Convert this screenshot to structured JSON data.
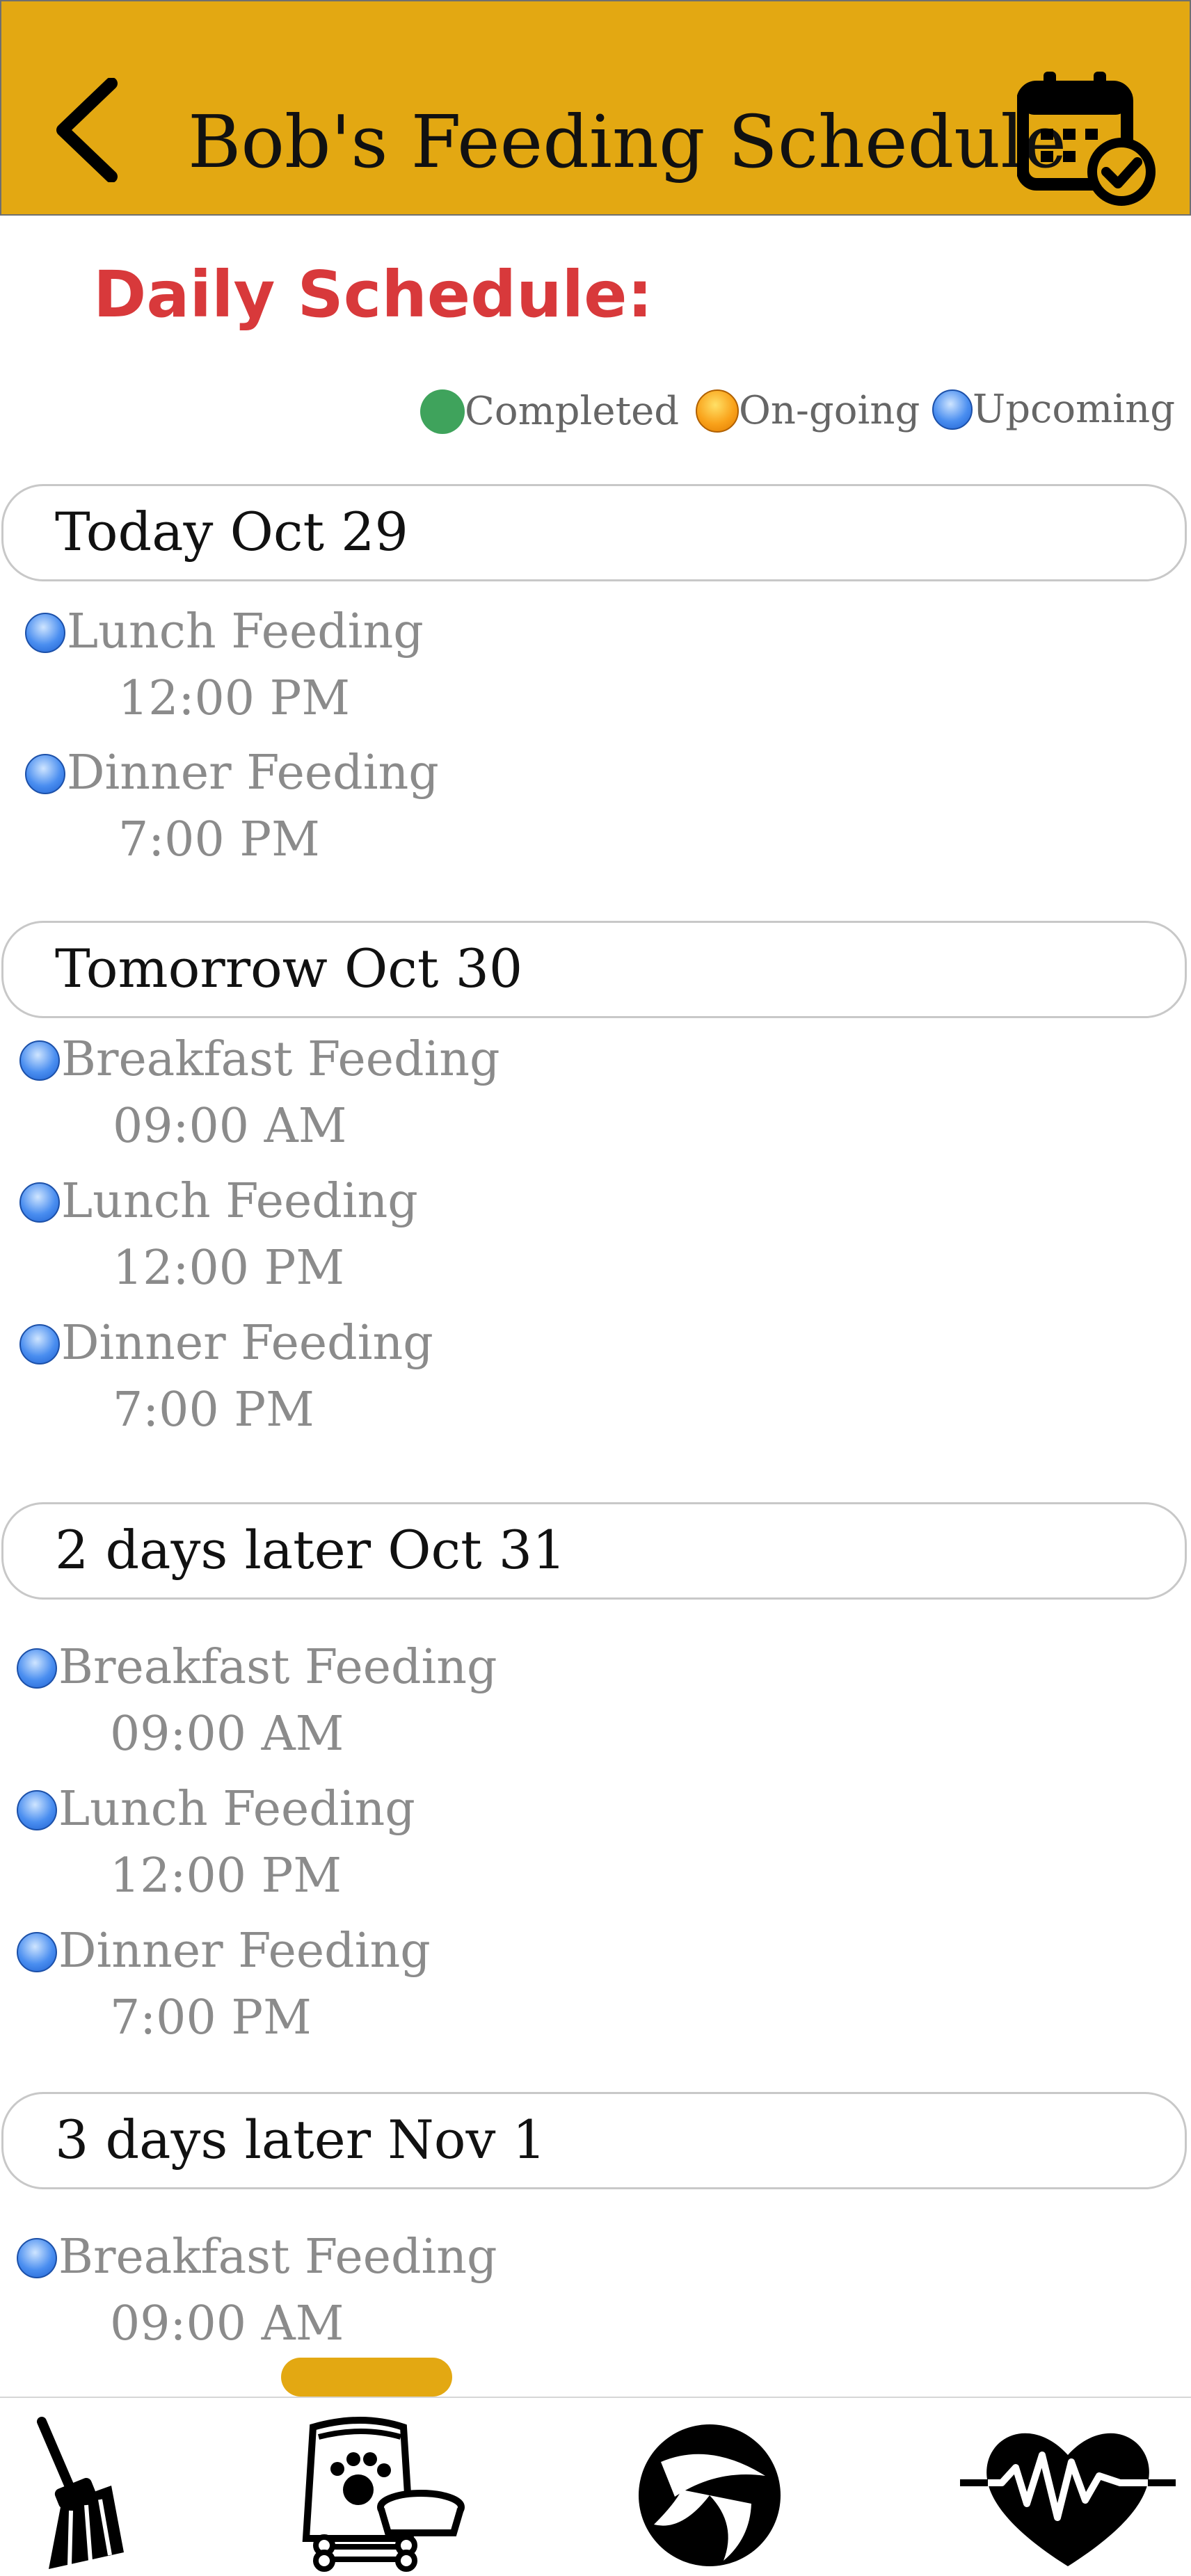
{
  "header": {
    "title": "Bob's Feeding Schedule"
  },
  "section_title": "Daily Schedule:",
  "legend": [
    {
      "label": "Completed",
      "color": "#3fa35c"
    },
    {
      "label": "On-going",
      "color": "#f9a21a"
    },
    {
      "label": "Upcoming",
      "color": "#4a8ef0"
    }
  ],
  "days": [
    {
      "label": "Today Oct 29",
      "items": [
        {
          "name": "Lunch Feeding",
          "time": "12:00 PM"
        },
        {
          "name": "Dinner Feeding",
          "time": "7:00 PM"
        }
      ]
    },
    {
      "label": "Tomorrow Oct 30",
      "items": [
        {
          "name": "Breakfast Feeding",
          "time": "09:00 AM"
        },
        {
          "name": "Lunch Feeding",
          "time": "12:00 PM"
        },
        {
          "name": "Dinner Feeding",
          "time": "7:00 PM"
        }
      ]
    },
    {
      "label": "2 days later Oct 31",
      "items": [
        {
          "name": "Breakfast Feeding",
          "time": "09:00 AM"
        },
        {
          "name": "Lunch Feeding",
          "time": "12:00 PM"
        },
        {
          "name": "Dinner Feeding",
          "time": "7:00 PM"
        }
      ]
    },
    {
      "label": "3 days later Nov 1",
      "items": [
        {
          "name": "Breakfast Feeding",
          "time": "09:00 AM"
        }
      ]
    }
  ],
  "colors": {
    "accent": "#e3a812",
    "heading": "#d8393b"
  },
  "tabs": [
    {
      "icon": "broom-icon"
    },
    {
      "icon": "pet-food-icon"
    },
    {
      "icon": "ball-icon"
    },
    {
      "icon": "heartbeat-icon"
    }
  ]
}
